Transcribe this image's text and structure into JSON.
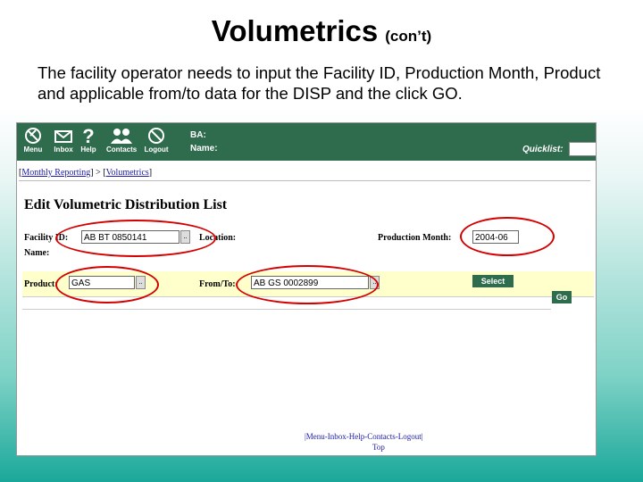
{
  "slide": {
    "title": "Volumetrics",
    "title_suffix": "(con’t)",
    "body": "The facility operator needs to input the Facility ID, Production Month, Product and applicable from/to data for the DISP and the click GO."
  },
  "app": {
    "nav": [
      {
        "label": "Menu",
        "icon": "menu-icon"
      },
      {
        "label": "Inbox",
        "icon": "envelope-icon"
      },
      {
        "label": "Help",
        "icon": "question-icon"
      },
      {
        "label": "Contacts",
        "icon": "people-icon"
      },
      {
        "label": "Logout",
        "icon": "no-entry-icon"
      }
    ],
    "ba_label": "BA:",
    "name_label": "Name:",
    "quicklist_label": "Quicklist:",
    "breadcrumb": {
      "first": "Monthly Reporting",
      "separator": ">",
      "second": "Volumetrics"
    },
    "page_heading": "Edit Volumetric Distribution List",
    "form": {
      "facility_id_label": "Facility ID:",
      "facility_id_value": "AB BT 0850141",
      "name_label": "Name:",
      "location_label": "Location:",
      "production_month_label": "Production Month:",
      "production_month_value": "2004-06",
      "product_label": "Product:",
      "product_value": "GAS",
      "from_to_label": "From/To:",
      "from_to_value": "AB GS 0002899",
      "lookup_button": "..",
      "select_button": "Select",
      "go_button": "Go"
    },
    "footer": {
      "links": "|Menu-Inbox-Help-Contacts-Logout|",
      "top": "Top"
    }
  },
  "colors": {
    "nav_bg": "#2f6b4d",
    "highlight": "#d40000",
    "filter_band": "#ffffcc",
    "link": "#1a1aa6"
  }
}
